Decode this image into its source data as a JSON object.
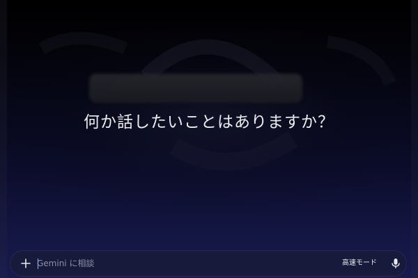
{
  "main": {
    "headline": "何か話したいことはありますか？"
  },
  "composer": {
    "add_icon": "plus-icon",
    "placeholder": "Gemini に相談",
    "value": "",
    "mode_label": "高速モード",
    "mic_icon": "microphone-icon"
  },
  "colors": {
    "background_top": "#000000",
    "background_bottom": "#181a4e",
    "composer_bg": "#171a3a",
    "text": "#ececf1",
    "placeholder": "#8e90a6",
    "caret": "#8ab4f8"
  }
}
